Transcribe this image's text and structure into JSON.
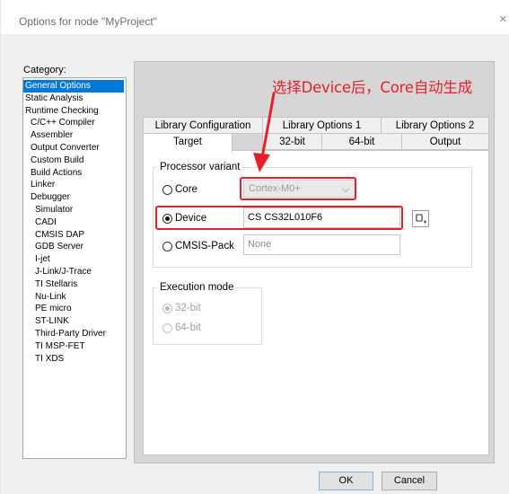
{
  "window": {
    "title": "Options for node \"MyProject\"",
    "close_glyph": "×"
  },
  "sidebar": {
    "label": "Category:",
    "items": [
      {
        "label": "General Options",
        "selected": true
      },
      {
        "label": "Static Analysis"
      },
      {
        "label": "Runtime Checking"
      },
      {
        "label": "C/C++ Compiler"
      },
      {
        "label": "Assembler"
      },
      {
        "label": "Output Converter"
      },
      {
        "label": "Custom Build"
      },
      {
        "label": "Build Actions"
      },
      {
        "label": "Linker"
      },
      {
        "label": "Debugger"
      },
      {
        "label": "Simulator"
      },
      {
        "label": "CADI"
      },
      {
        "label": "CMSIS DAP"
      },
      {
        "label": "GDB Server"
      },
      {
        "label": "I-jet"
      },
      {
        "label": "J-Link/J-Trace"
      },
      {
        "label": "TI Stellaris"
      },
      {
        "label": "Nu-Link"
      },
      {
        "label": "PE micro"
      },
      {
        "label": "ST-LINK"
      },
      {
        "label": "Third-Party Driver"
      },
      {
        "label": "TI MSP-FET"
      },
      {
        "label": "TI XDS"
      }
    ]
  },
  "tabs": {
    "row1": [
      "Library Configuration",
      "Library Options 1",
      "Library Options 2"
    ],
    "row2": [
      "Target",
      "32-bit",
      "64-bit",
      "Output"
    ],
    "active": "Target"
  },
  "processor_variant": {
    "title": "Processor variant",
    "core_label": "Core",
    "core_value": "Cortex-M0+",
    "device_label": "Device",
    "device_value": "CS CS32L010F6",
    "cmsis_label": "CMSIS-Pack",
    "cmsis_value": "None",
    "selected": "Device"
  },
  "execution_mode": {
    "title": "Execution mode",
    "options": [
      "32-bit",
      "64-bit"
    ],
    "selected": "32-bit"
  },
  "annotation": {
    "text": "选择Device后，Core自动生成",
    "color": "#e5202a"
  },
  "buttons": {
    "ok": "OK",
    "cancel": "Cancel"
  },
  "icons": {
    "device_browse": "device-select-icon",
    "dropdown": "chevron-down-icon",
    "close": "close-icon"
  }
}
